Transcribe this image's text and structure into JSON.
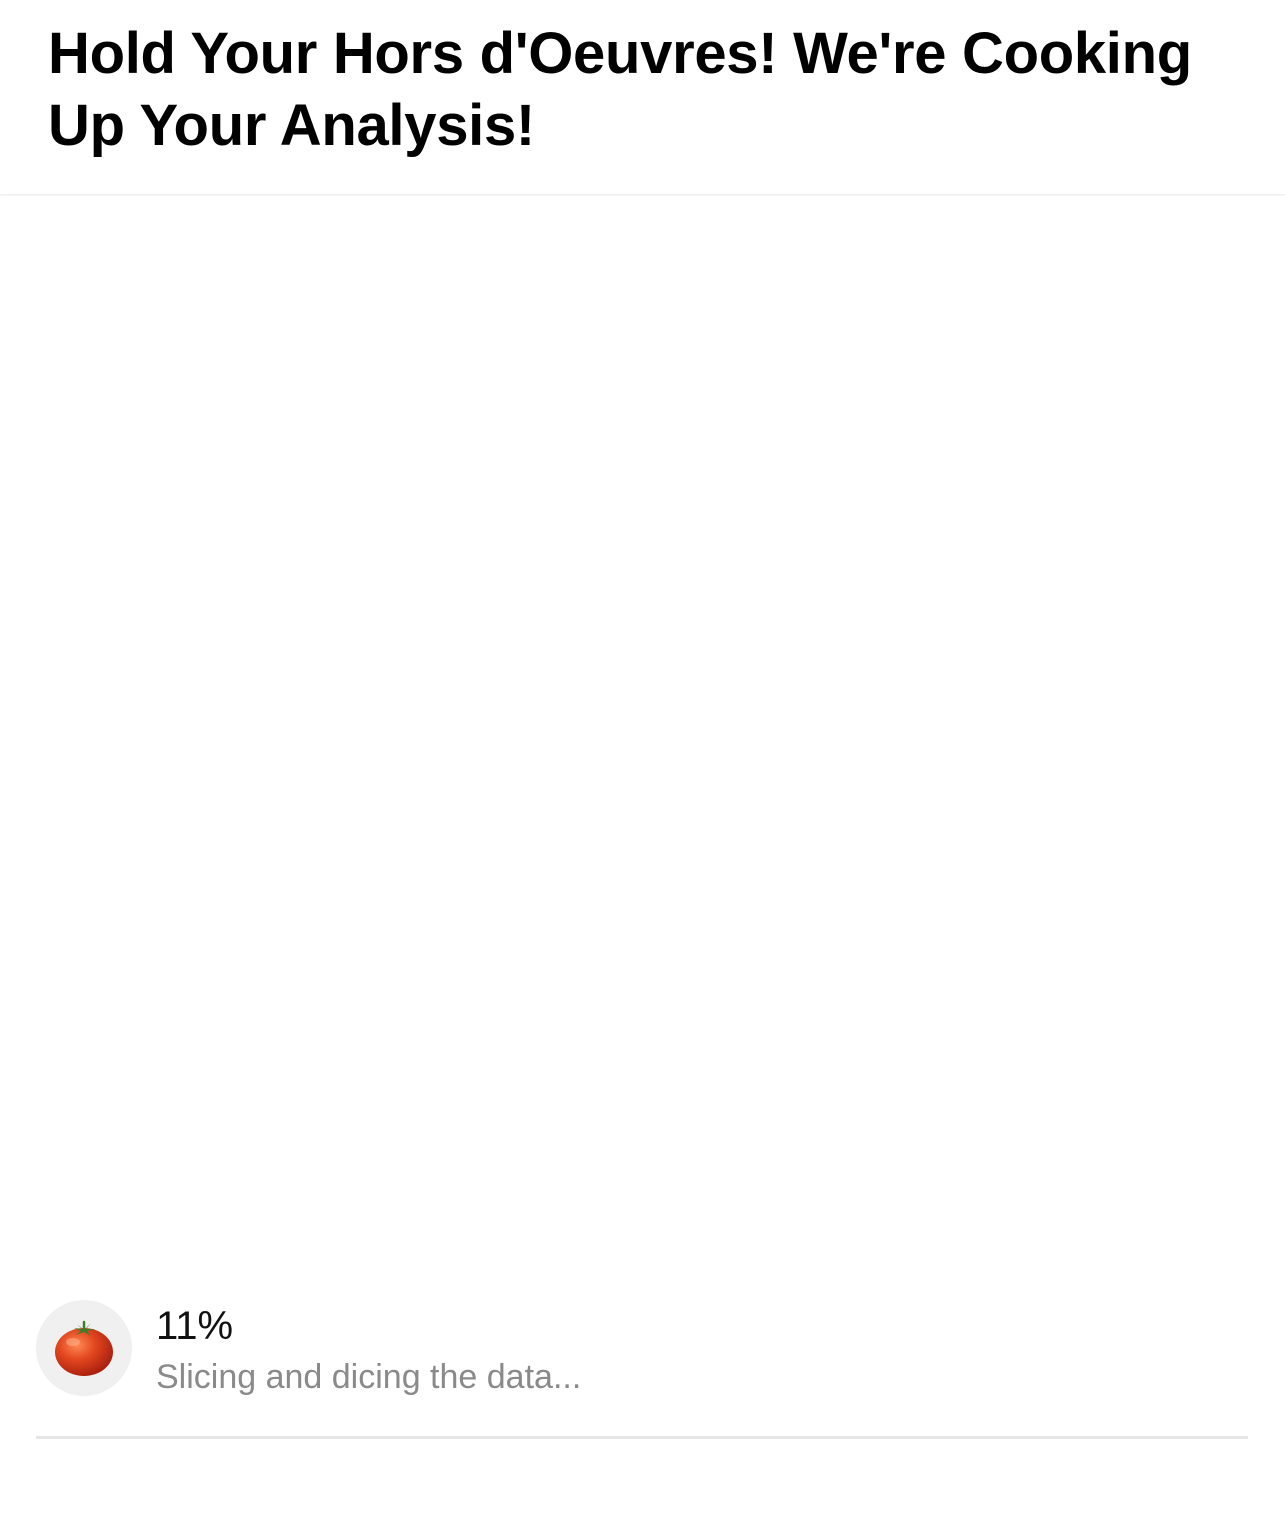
{
  "header": {
    "title": "Hold Your Hors d'Oeuvres! We're Cooking Up Your Analysis!"
  },
  "progress": {
    "percent_label": "11%",
    "value": 0.11,
    "status": "Slicing and dicing the data...",
    "icon": "tomato-icon"
  },
  "colors": {
    "background": "#ffffff",
    "avatar_bg": "#f0f0f0",
    "status_text": "#8a8a8a",
    "divider": "#e6e6e6",
    "tomato": "#d93a1c"
  }
}
